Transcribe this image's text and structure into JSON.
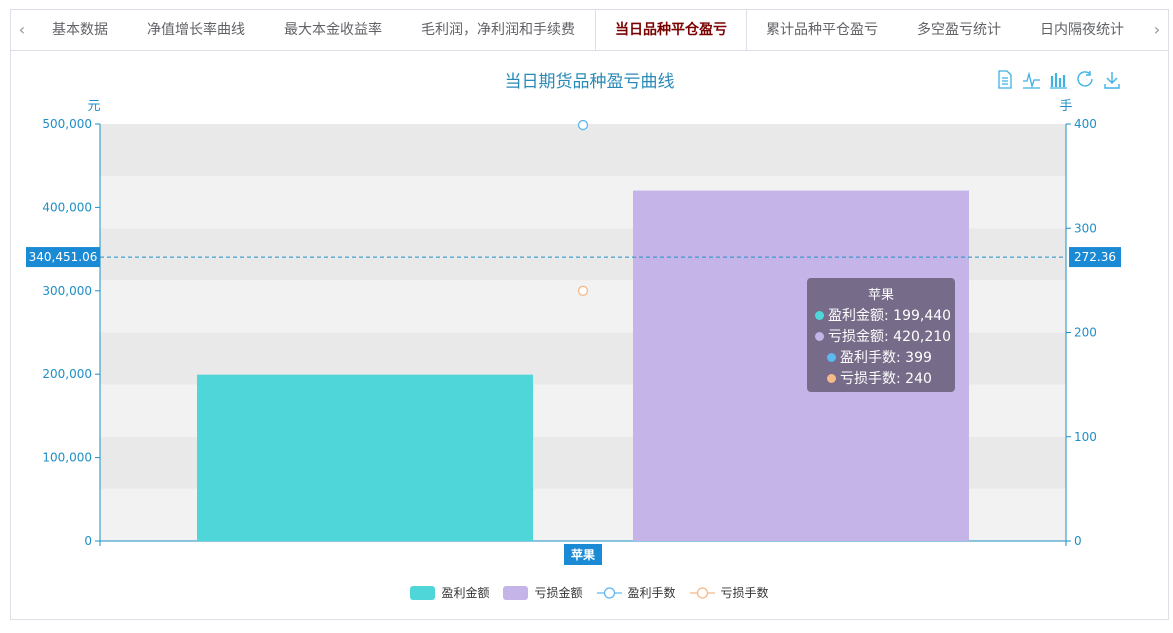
{
  "tabs": {
    "prev_glyph": "‹",
    "next_glyph": "›",
    "items": [
      {
        "label": "基本数据"
      },
      {
        "label": "净值增长率曲线"
      },
      {
        "label": "最大本金收益率"
      },
      {
        "label": "毛利润，净利润和手续费"
      },
      {
        "label": "当日品种平仓盈亏"
      },
      {
        "label": "累计品种平仓盈亏"
      },
      {
        "label": "多空盈亏统计"
      },
      {
        "label": "日内隔夜统计"
      }
    ],
    "active_index": 4
  },
  "toolbox": {
    "icons": [
      "data-view-icon",
      "line-chart-icon",
      "bar-chart-icon",
      "refresh-icon",
      "download-icon"
    ],
    "color": "#3fb1e3"
  },
  "chart_data": {
    "type": "bar",
    "title": "当日期货品种盈亏曲线",
    "categories": [
      "苹果"
    ],
    "y_left": {
      "unit_label": "元",
      "range": [
        0,
        500000
      ],
      "ticks": [
        "0",
        "100,000",
        "200,000",
        "300,000",
        "400,000",
        "500,000"
      ]
    },
    "y_right": {
      "unit_label": "手",
      "range": [
        0,
        400
      ],
      "ticks": [
        "0",
        "100",
        "200",
        "300",
        "400"
      ]
    },
    "series": [
      {
        "name": "盈利金额",
        "kind": "bar",
        "axis": "left",
        "values": [
          199440
        ],
        "color": "#4fd6d9",
        "display": "199,440"
      },
      {
        "name": "亏损金额",
        "kind": "bar",
        "axis": "left",
        "values": [
          420210
        ],
        "color": "#c5b4e8",
        "display": "420,210"
      },
      {
        "name": "盈利手数",
        "kind": "line",
        "axis": "right",
        "values": [
          399
        ],
        "color": "#5fb7f0",
        "display": "399"
      },
      {
        "name": "亏损手数",
        "kind": "line",
        "axis": "right",
        "values": [
          240
        ],
        "color": "#f5b98a",
        "display": "240"
      }
    ],
    "crosshair": {
      "left_value": 340451.06,
      "left_label": "340,451.06",
      "right_label": "272.36",
      "category_label": "苹果"
    },
    "grid": true,
    "legend_position": "bottom-center",
    "tooltip": {
      "title": "苹果",
      "visible": true
    },
    "colors": {
      "axis": "#1f8fc7",
      "label_bg": "#1a8ad4",
      "band_a": "#f2f2f2",
      "band_b": "#e9e9e9"
    }
  }
}
